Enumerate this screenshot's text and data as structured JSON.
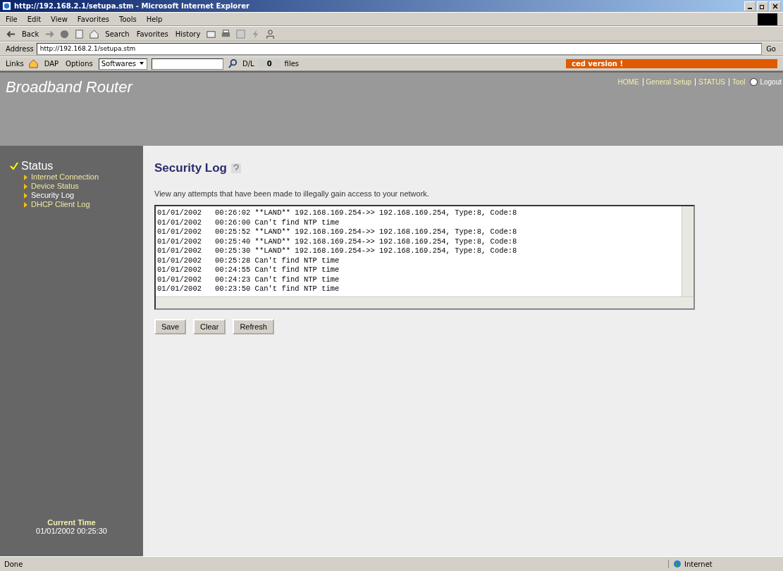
{
  "window": {
    "title": "http://192.168.2.1/setupa.stm - Microsoft Internet Explorer"
  },
  "menu": [
    "File",
    "Edit",
    "View",
    "Favorites",
    "Tools",
    "Help"
  ],
  "toolbar": {
    "back": "Back",
    "search": "Search",
    "favorites": "Favorites",
    "history": "History"
  },
  "address_bar": {
    "label": "Address",
    "value": "http://192.168.2.1/setupa.stm",
    "go": "Go"
  },
  "links_bar": {
    "label": "Links",
    "items": [
      "DAP",
      "Options"
    ],
    "dropdown": "Softwares",
    "dl_label": "D/L",
    "dl_count": "0",
    "files": "files",
    "banner": "ced version !"
  },
  "header": {
    "title": "Broadband Router",
    "nav": [
      "HOME",
      "General Setup",
      "STATUS",
      "Tool"
    ],
    "logout": "Logout"
  },
  "sidebar": {
    "section": "Status",
    "items": [
      {
        "label": "Internet Connection",
        "selected": false
      },
      {
        "label": "Device Status",
        "selected": false
      },
      {
        "label": "Security Log",
        "selected": true
      },
      {
        "label": "DHCP Client Log",
        "selected": false
      }
    ],
    "time_label": "Current Time",
    "time_value": "01/01/2002 00:25:30"
  },
  "content": {
    "title": "Security Log",
    "description": "View any attempts that have been made to illegally gain access to your network.",
    "log": [
      "01/01/2002   00:26:02 **LAND** 192.168.169.254->> 192.168.169.254, Type:8, Code:8",
      "01/01/2002   00:26:00 Can't find NTP time",
      "01/01/2002   00:25:52 **LAND** 192.168.169.254->> 192.168.169.254, Type:8, Code:8",
      "01/01/2002   00:25:40 **LAND** 192.168.169.254->> 192.168.169.254, Type:8, Code:8",
      "01/01/2002   00:25:30 **LAND** 192.168.169.254->> 192.168.169.254, Type:8, Code:8",
      "01/01/2002   00:25:28 Can't find NTP time",
      "01/01/2002   00:24:55 Can't find NTP time",
      "01/01/2002   00:24:23 Can't find NTP time",
      "01/01/2002   00:23:50 Can't find NTP time"
    ],
    "buttons": [
      "Save",
      "Clear",
      "Refresh"
    ]
  },
  "status_bar": {
    "text": "Done",
    "zone": "Internet"
  }
}
